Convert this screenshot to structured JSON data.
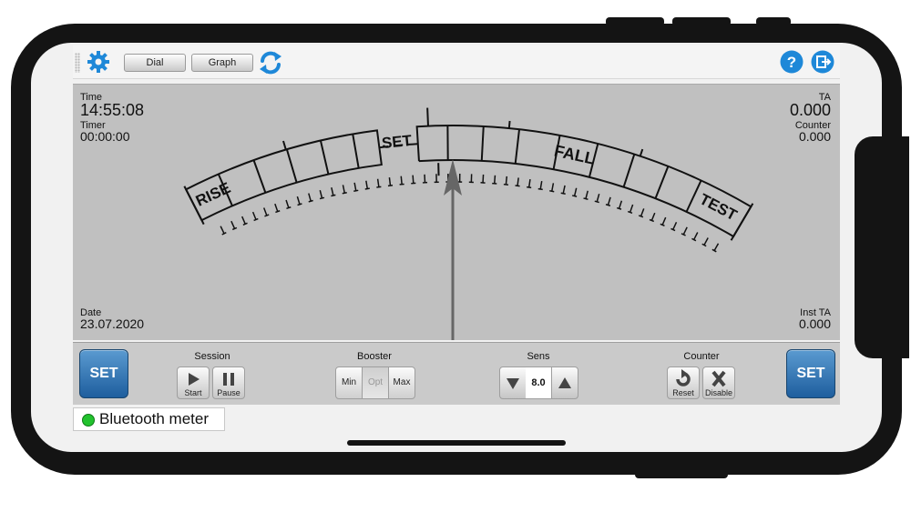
{
  "toolbar": {
    "dial_label": "Dial",
    "graph_label": "Graph"
  },
  "dial": {
    "time_label": "Time",
    "time_value": "14:55:08",
    "timer_label": "Timer",
    "timer_value": "00:00:00",
    "date_label": "Date",
    "date_value": "23.07.2020",
    "ta_label": "TA",
    "ta_value": "0.000",
    "counter_label": "Counter",
    "counter_value": "0.000",
    "inst_ta_label": "Inst TA",
    "inst_ta_value": "0.000",
    "scale_labels": {
      "rise": "RISE",
      "set": "SET",
      "fall": "FALL",
      "test": "TEST"
    }
  },
  "controls": {
    "set_left": "SET",
    "set_right": "SET",
    "session_title": "Session",
    "start_label": "Start",
    "pause_label": "Pause",
    "booster_title": "Booster",
    "booster_options": [
      "Min",
      "Opt",
      "Max"
    ],
    "booster_selected": "Opt",
    "sens_title": "Sens",
    "sens_value": "8.0",
    "counter_title": "Counter",
    "reset_label": "Reset",
    "disable_label": "Disable"
  },
  "status": {
    "connection_text": "Bluetooth meter",
    "connection_color": "#22c22e"
  },
  "colors": {
    "accent": "#1e88d8",
    "set_button": "#2a6aa8",
    "dial_background": "#c0c0c0"
  }
}
